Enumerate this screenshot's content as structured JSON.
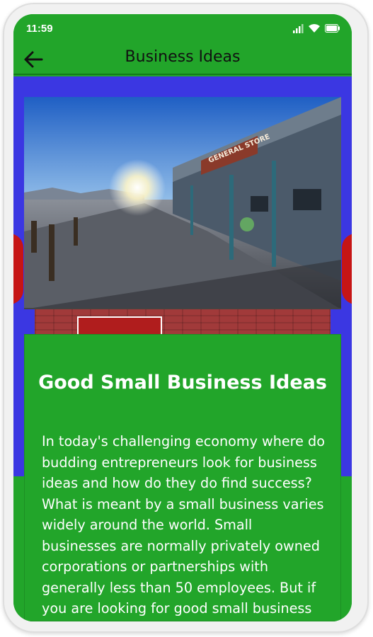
{
  "status_bar": {
    "time": "11:59",
    "icons": [
      "signal-icon",
      "wifi-icon",
      "battery-icon"
    ]
  },
  "app_bar": {
    "title": "Business Ideas",
    "back_icon": "arrow-left-icon"
  },
  "hero": {
    "sign_text": "GENERAL STORE"
  },
  "article": {
    "title": "Good Small Business Ideas",
    "body": "In today's challenging economy where do budding entrepreneurs look for business ideas and how do they do find success? What is meant by a small business varies widely around the world. Small businesses are normally privately owned corporations or partnerships with generally less than 50 employees. But if you are looking for good small business ideas, starting business with"
  },
  "colors": {
    "primary_green": "#22a52a",
    "blue_background": "#3b37e2",
    "accent_red": "#c61515"
  }
}
